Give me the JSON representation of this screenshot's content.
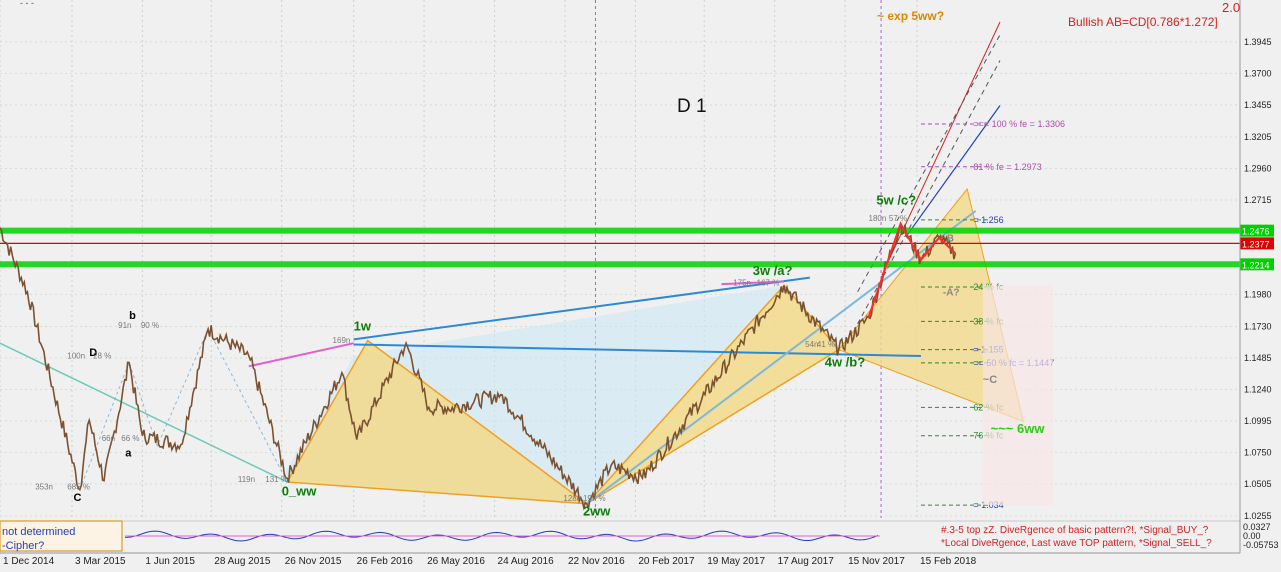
{
  "chart_data": {
    "type": "line",
    "instrument_timeframe": "D 1",
    "top_right_label": "2.0",
    "top_corner_marker": "- - -",
    "headline_annotations": {
      "exp": "~ exp 5ww?",
      "abcd": "Bullish AB=CD[0.786*1.272]"
    },
    "ylim": [
      1.0255,
      1.41
    ],
    "y_ticks": [
      "1.3945",
      "1.3700",
      "1.3455",
      "1.3205",
      "1.2960",
      "1.2715",
      "1.2476",
      "1.2377",
      "1.2214",
      "1.1980",
      "1.1730",
      "1.1485",
      "1.1240",
      "1.0995",
      "1.0750",
      "1.0505",
      "1.0255"
    ],
    "x_ticks": [
      "1 Dec 2014",
      "3 Mar 2015",
      "1 Jun 2015",
      "28 Aug 2015",
      "26 Nov 2015",
      "26 Feb 2016",
      "26 May 2016",
      "24 Aug 2016",
      "22 Nov 2016",
      "20 Feb 2017",
      "19 May 2017",
      "17 Aug 2017",
      "15 Nov 2017",
      "15 Feb 2018"
    ],
    "price_key_points": [
      {
        "date": "2014-12-01",
        "price": 1.25
      },
      {
        "date": "2015-01-05",
        "price": 1.2
      },
      {
        "date": "2015-03-13",
        "price": 1.046
      },
      {
        "date": "2015-03-25",
        "price": 1.1
      },
      {
        "date": "2015-04-13",
        "price": 1.053
      },
      {
        "date": "2015-05-15",
        "price": 1.145
      },
      {
        "date": "2015-06-01",
        "price": 1.088
      },
      {
        "date": "2015-07-20",
        "price": 1.081
      },
      {
        "date": "2015-08-24",
        "price": 1.171
      },
      {
        "date": "2015-10-15",
        "price": 1.15
      },
      {
        "date": "2015-12-03",
        "price": 1.055
      },
      {
        "date": "2016-02-11",
        "price": 1.137
      },
      {
        "date": "2016-03-01",
        "price": 1.085
      },
      {
        "date": "2016-05-03",
        "price": 1.16
      },
      {
        "date": "2016-06-01",
        "price": 1.11
      },
      {
        "date": "2016-07-01",
        "price": 1.11
      },
      {
        "date": "2016-09-01",
        "price": 1.12
      },
      {
        "date": "2016-12-20",
        "price": 1.035
      },
      {
        "date": "2017-01-20",
        "price": 1.065
      },
      {
        "date": "2017-03-01",
        "price": 1.055
      },
      {
        "date": "2017-05-20",
        "price": 1.12
      },
      {
        "date": "2017-08-29",
        "price": 1.205
      },
      {
        "date": "2017-11-07",
        "price": 1.155
      },
      {
        "date": "2017-12-15",
        "price": 1.18
      },
      {
        "date": "2018-01-25",
        "price": 1.253
      },
      {
        "date": "2018-02-20",
        "price": 1.225
      },
      {
        "date": "2018-03-15",
        "price": 1.242
      },
      {
        "date": "2018-04-05",
        "price": 1.23
      }
    ],
    "price_lines": [
      {
        "label": "1.2476",
        "value": 1.2476,
        "color": "#00d200"
      },
      {
        "label": "1.2377",
        "value": 1.2377,
        "color": "#e00000"
      },
      {
        "label": "1.2214",
        "value": 1.2214,
        "color": "#00d200"
      }
    ],
    "fib_levels": [
      {
        "label": "=== 100 % fe = 1.3306",
        "value": 1.3306
      },
      {
        "label": "81 % fe = 1.2973",
        "value": 1.2973
      },
      {
        "label": "= 1.256",
        "value": 1.256
      },
      {
        "label": "24 % fc",
        "value": 1.2037
      },
      {
        "label": "38 % fc",
        "value": 1.177
      },
      {
        "label": "= 1.155",
        "value": 1.155
      },
      {
        "label": "== 50 % fc = 1.1447",
        "value": 1.1447
      },
      {
        "label": "62 % fc",
        "value": 1.11
      },
      {
        "label": "76 % fc",
        "value": 1.088
      },
      {
        "label": "= 1.034",
        "value": 1.034
      }
    ],
    "wave_labels": [
      {
        "text": "0_ww",
        "color": "#0a7d0a"
      },
      {
        "text": "1w",
        "color": "#0a7d0a"
      },
      {
        "text": "2ww",
        "color": "#0a7d0a"
      },
      {
        "text": "3w /a?",
        "color": "#0a7d0a"
      },
      {
        "text": "4w /b?",
        "color": "#0a7d0a"
      },
      {
        "text": "5w /c?",
        "color": "#0a7d0a"
      },
      {
        "text": "~~~ 6ww",
        "color": "#2ecc1a"
      },
      {
        "text": "b",
        "color": "#000000"
      },
      {
        "text": "D",
        "color": "#000000"
      },
      {
        "text": "a",
        "color": "#000000"
      },
      {
        "text": "C",
        "color": "#000000"
      },
      {
        "text": "~C",
        "color": "#888888"
      },
      {
        "text": "-A?",
        "color": "#888888"
      },
      {
        "text": "B",
        "color": "#888888"
      }
    ],
    "small_annotations": [
      "91n",
      "90 %",
      "100n",
      "28 %",
      "66n",
      "66 %",
      "353n",
      "685 %",
      "119n",
      "131 %",
      "169n",
      "175n",
      "167 %",
      "54n",
      "41 %",
      "180n",
      "57 %",
      "128n",
      "197 %"
    ],
    "indicator": {
      "left_labels": [
        "not determined",
        "-Cipher?"
      ],
      "right_values": [
        "0.0327",
        "0.00",
        "-0.05753"
      ],
      "notes": [
        "#.3-5 top zZ. DiveRgence of basic pattern?!, *Signal_BUY_?",
        "*Local DiveRgence, Last wave TOP pattern, *Signal_SELL_?"
      ]
    },
    "colors": {
      "background": "#f0f0f0",
      "bull_candle": "#ff2a2a",
      "bear_candle": "#7a5230",
      "pattern_fill": "#f2d98a",
      "channel_fill": "#c8e8f8",
      "wave_label": "#0a7d0a",
      "fib_label": "#2e8b2e",
      "annotation_red": "#d62020",
      "annotation_orange": "#d98a00",
      "trend_blue": "#1f3fbf"
    }
  }
}
